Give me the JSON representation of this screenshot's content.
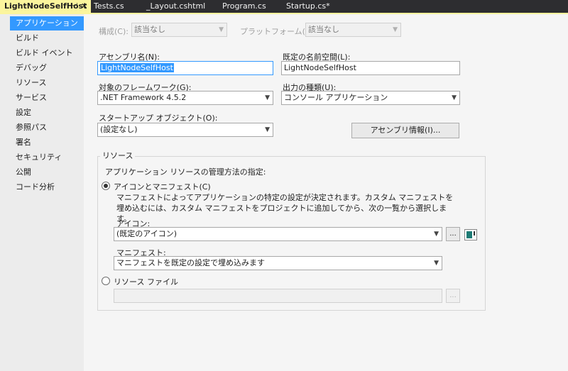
{
  "tabs": {
    "active": "LightNodeSelfHost",
    "pin_glyph": "⊣",
    "close_glyph": "✕",
    "others": [
      "Tests.cs",
      "_Layout.cshtml",
      "Program.cs",
      "Startup.cs*"
    ]
  },
  "sidebar": {
    "items": [
      "アプリケーション",
      "ビルド",
      "ビルド イベント",
      "デバッグ",
      "リソース",
      "サービス",
      "設定",
      "参照パス",
      "署名",
      "セキュリティ",
      "公開",
      "コード分析"
    ]
  },
  "config": {
    "config_label": "構成(C):",
    "config_value": "該当なし",
    "platform_label": "プラットフォーム(M):",
    "platform_value": "該当なし"
  },
  "assembly": {
    "name_label": "アセンブリ名(N):",
    "name_value": "LightNodeSelfHost",
    "namespace_label": "既定の名前空間(L):",
    "namespace_value": "LightNodeSelfHost"
  },
  "framework": {
    "label": "対象のフレームワーク(G):",
    "value": ".NET Framework 4.5.2"
  },
  "output": {
    "label": "出力の種類(U):",
    "value": "コンソール アプリケーション"
  },
  "startup": {
    "label": "スタートアップ オブジェクト(O):",
    "value": "(設定なし)"
  },
  "assembly_info_button": "アセンブリ情報(I)...",
  "resources": {
    "group_title": "リソース",
    "instruction": "アプリケーション リソースの管理方法の指定:",
    "icon_manifest_radio": "アイコンとマニフェスト(C)",
    "description": "マニフェストによってアプリケーションの特定の設定が決定されます。カスタム マニフェストを埋め込むには、カスタム マニフェストをプロジェクトに追加してから、次の一覧から選択します。",
    "icon_label": "アイコン:",
    "icon_value": "(既定のアイコン)",
    "browse_label": "...",
    "manifest_label": "マニフェスト:",
    "manifest_value": "マニフェストを既定の設定で埋め込みます",
    "resource_file_radio": "リソース ファイル",
    "resource_file_value": ""
  },
  "dropdown_arrow": "▼"
}
